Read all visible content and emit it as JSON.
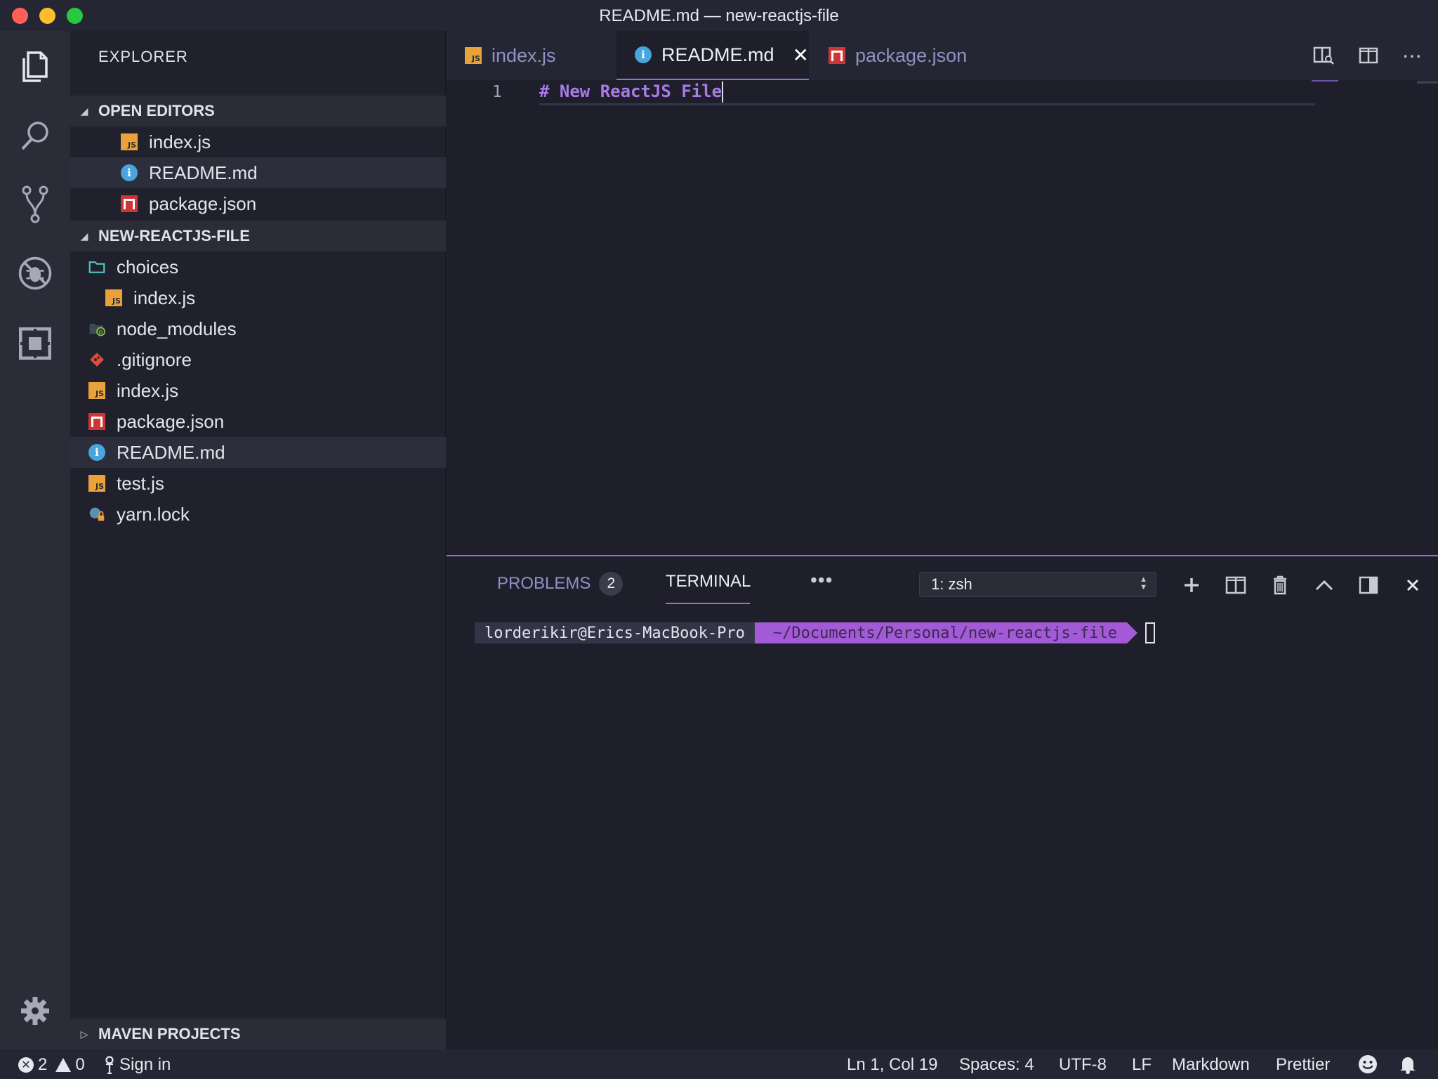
{
  "window": {
    "title": "README.md — new-reactjs-file"
  },
  "sidebar": {
    "title": "EXPLORER",
    "open_editors": {
      "label": "OPEN EDITORS",
      "items": [
        {
          "name": "index.js",
          "icon": "js-file-icon"
        },
        {
          "name": "README.md",
          "icon": "info-file-icon",
          "selected": true
        },
        {
          "name": "package.json",
          "icon": "npm-file-icon"
        }
      ]
    },
    "project": {
      "label": "NEW-REACTJS-FILE",
      "items": [
        {
          "name": "choices",
          "icon": "folder-icon"
        },
        {
          "name": "index.js",
          "icon": "js-file-icon"
        },
        {
          "name": "node_modules",
          "icon": "node-folder-icon"
        },
        {
          "name": ".gitignore",
          "icon": "git-icon"
        },
        {
          "name": "index.js",
          "icon": "js-file-icon"
        },
        {
          "name": "package.json",
          "icon": "npm-file-icon"
        },
        {
          "name": "README.md",
          "icon": "info-file-icon",
          "selected": true
        },
        {
          "name": "test.js",
          "icon": "js-file-icon"
        },
        {
          "name": "yarn.lock",
          "icon": "yarn-lock-icon"
        }
      ]
    },
    "maven": {
      "label": "MAVEN PROJECTS"
    }
  },
  "tabs": [
    {
      "label": "index.js",
      "icon": "js-file-icon"
    },
    {
      "label": "README.md",
      "icon": "info-file-icon",
      "active": true
    },
    {
      "label": "package.json",
      "icon": "npm-file-icon"
    }
  ],
  "editor": {
    "line_number": "1",
    "line_text": "# New ReactJS File"
  },
  "panel": {
    "problems_label": "PROBLEMS",
    "problems_count": "2",
    "terminal_label": "TERMINAL",
    "more": "•••",
    "terminal_select": "1: zsh",
    "prompt_user": "lorderikir@Erics-MacBook-Pro",
    "prompt_path": "~/Documents/Personal/new-reactjs-file"
  },
  "status": {
    "errors": "2",
    "warnings": "0",
    "sign_in": "Sign in",
    "position": "Ln 1, Col 19",
    "spaces": "Spaces: 4",
    "encoding": "UTF-8",
    "eol": "LF",
    "language": "Markdown",
    "formatter": "Prettier"
  },
  "colors": {
    "accent": "#9d6adf",
    "background": "#1e1f2a",
    "sidebar": "#20212c",
    "activity_bar": "#2a2c38"
  }
}
